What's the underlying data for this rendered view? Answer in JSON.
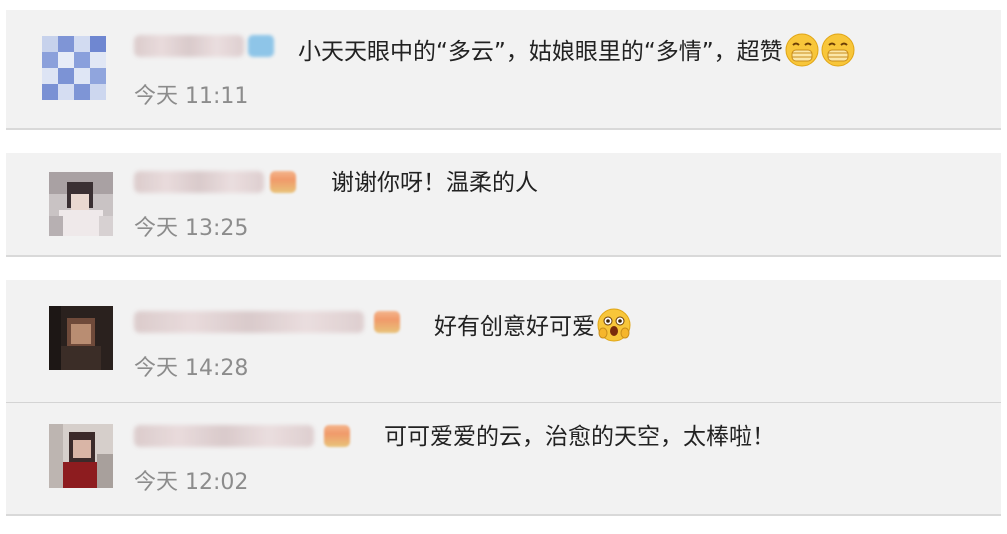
{
  "comments": [
    {
      "text": "小天天眼中的“多云”，姑娘眼里的“多情”，超赞",
      "emojis": [
        "mask-face-emoji",
        "mask-face-emoji"
      ],
      "time": "今天 11:11",
      "badge": "blue-v-badge"
    },
    {
      "text": "谢谢你呀！温柔的人",
      "emojis": [],
      "time": "今天 13:25",
      "badge": "level-crown-badge"
    },
    {
      "text": "好有创意好可爱",
      "emojis": [
        "shocked-face-emoji"
      ],
      "time": "今天 14:28",
      "badge": "level-crown-badge"
    },
    {
      "text": "可可爱爱的云，治愈的天空，太棒啦！",
      "emojis": [],
      "time": "今天 12:02",
      "badge": "level-crown-badge"
    }
  ],
  "colors": {
    "card_bg": "#f2f2f2",
    "text": "#222222",
    "time": "#8c8c8c",
    "separator": "#d9d9d9"
  }
}
